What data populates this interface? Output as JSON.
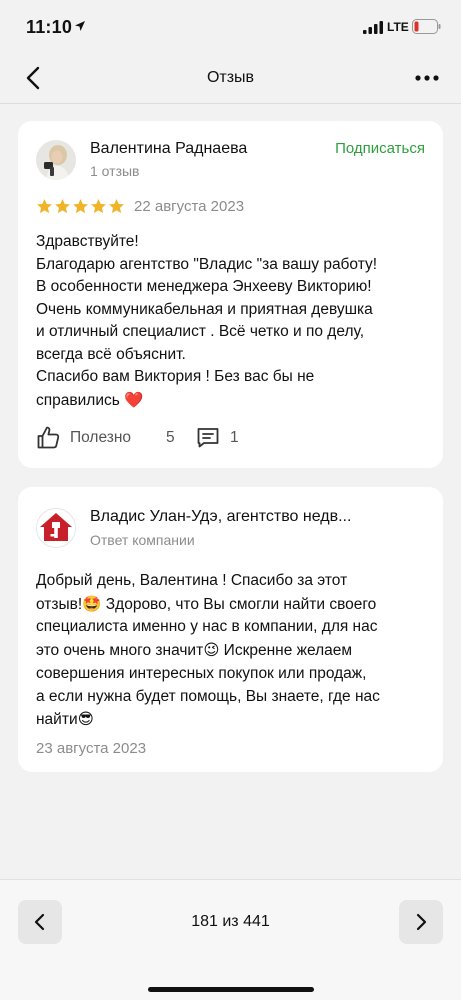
{
  "status_bar": {
    "time": "11:10",
    "network": "LTE",
    "battery_color": "#e0302a"
  },
  "nav": {
    "title": "Отзыв",
    "back_icon": "chevron-left-icon",
    "more_icon": "more-dots-icon"
  },
  "review": {
    "author": "Валентина Раднаева",
    "author_meta": "1 отзыв",
    "subscribe_label": "Подписаться",
    "rating": 5,
    "date": "22 августа 2023",
    "text": "Здравствуйте!\nБлагодарю агентство \"Владис \"за вашу работу!\nВ особенности менеджера Энхееву Викторию!\nОчень коммуникабельная и приятная девушка\nи отличный специалист . Всё четко и по делу,\nвсегда всё объяснит.\nСпасибо вам Виктория ! Без вас бы не\nсправились",
    "text_emoji": "❤️",
    "useful_label": "Полезно",
    "useful_count": "5",
    "comment_count": "1"
  },
  "reply": {
    "company": "Владис Улан-Удэ, агентство недв...",
    "company_meta": "Ответ компании",
    "text_1": "Добрый день, Валентина ! Спасибо за этот\nотзыв!",
    "emoji_1": "🤩",
    "text_2": " Здорово, что Вы смогли найти своего\nспециалиста именно у нас в компании, для нас\nэто очень много значит",
    "emoji_2": "😉",
    "text_3": " Искренне желаем\nсовершения интересных покупок или продаж,\nа если нужна будет помощь, Вы знаете, где нас\nнайти",
    "emoji_3": "😎",
    "date": "23 августа 2023"
  },
  "pager": {
    "text": "181 из 441"
  },
  "colors": {
    "accent_green": "#2e9e3f",
    "star": "#f0b429",
    "logo_red": "#c8202a"
  }
}
